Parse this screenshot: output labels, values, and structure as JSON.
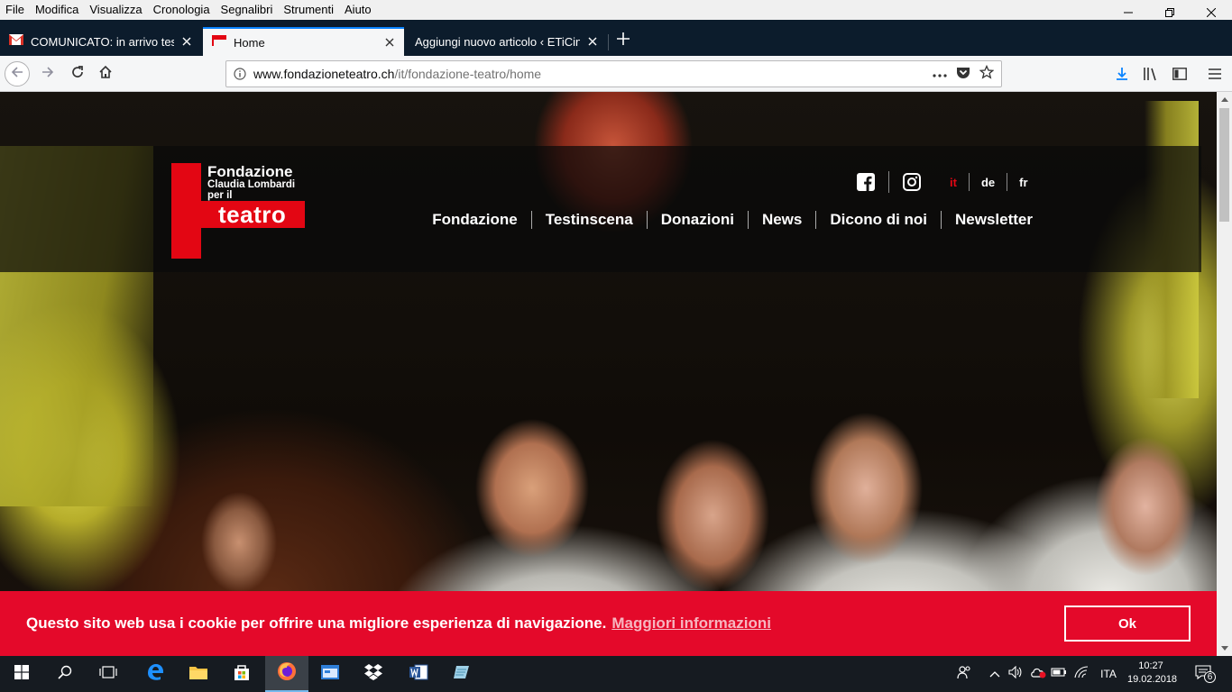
{
  "menubar": {
    "items": [
      "File",
      "Modifica",
      "Visualizza",
      "Cronologia",
      "Segnalibri",
      "Strumenti",
      "Aiuto"
    ]
  },
  "tabs": [
    {
      "title": "COMUNICATO: in arrivo testinscena",
      "icon": "gmail-icon",
      "active": false
    },
    {
      "title": "Home",
      "icon": "flag-icon",
      "active": true
    },
    {
      "title": "Aggiungi nuovo articolo ‹ ETiCinfo",
      "icon": "none",
      "active": false
    }
  ],
  "urlbar": {
    "host": "www.fondazioneteatro.ch",
    "path": "/it/fondazione-teatro/home"
  },
  "site": {
    "logo": {
      "line1": "Fondazione",
      "line2": "Claudia Lombardi",
      "line3": "per il",
      "line4": "teatro"
    },
    "languages": [
      {
        "label": "it",
        "current": true
      },
      {
        "label": "de",
        "current": false
      },
      {
        "label": "fr",
        "current": false
      }
    ],
    "nav": [
      "Fondazione",
      "Testinscena",
      "Donazioni",
      "News",
      "Dicono di noi",
      "Newsletter"
    ],
    "cookie": {
      "message": "Questo sito web usa i cookie per offrire una migliore esperienza di navigazione.",
      "more": "Maggiori informazioni",
      "ok": "Ok"
    }
  },
  "taskbar": {
    "lang": "ITA",
    "time": "10:27",
    "date": "19.02.2018",
    "notifications": "6"
  },
  "colors": {
    "brand_red": "#e30613",
    "cookie_red": "#e4092a",
    "tab_bar": "#0c1c2c",
    "accent_blue": "#0a84ff"
  }
}
